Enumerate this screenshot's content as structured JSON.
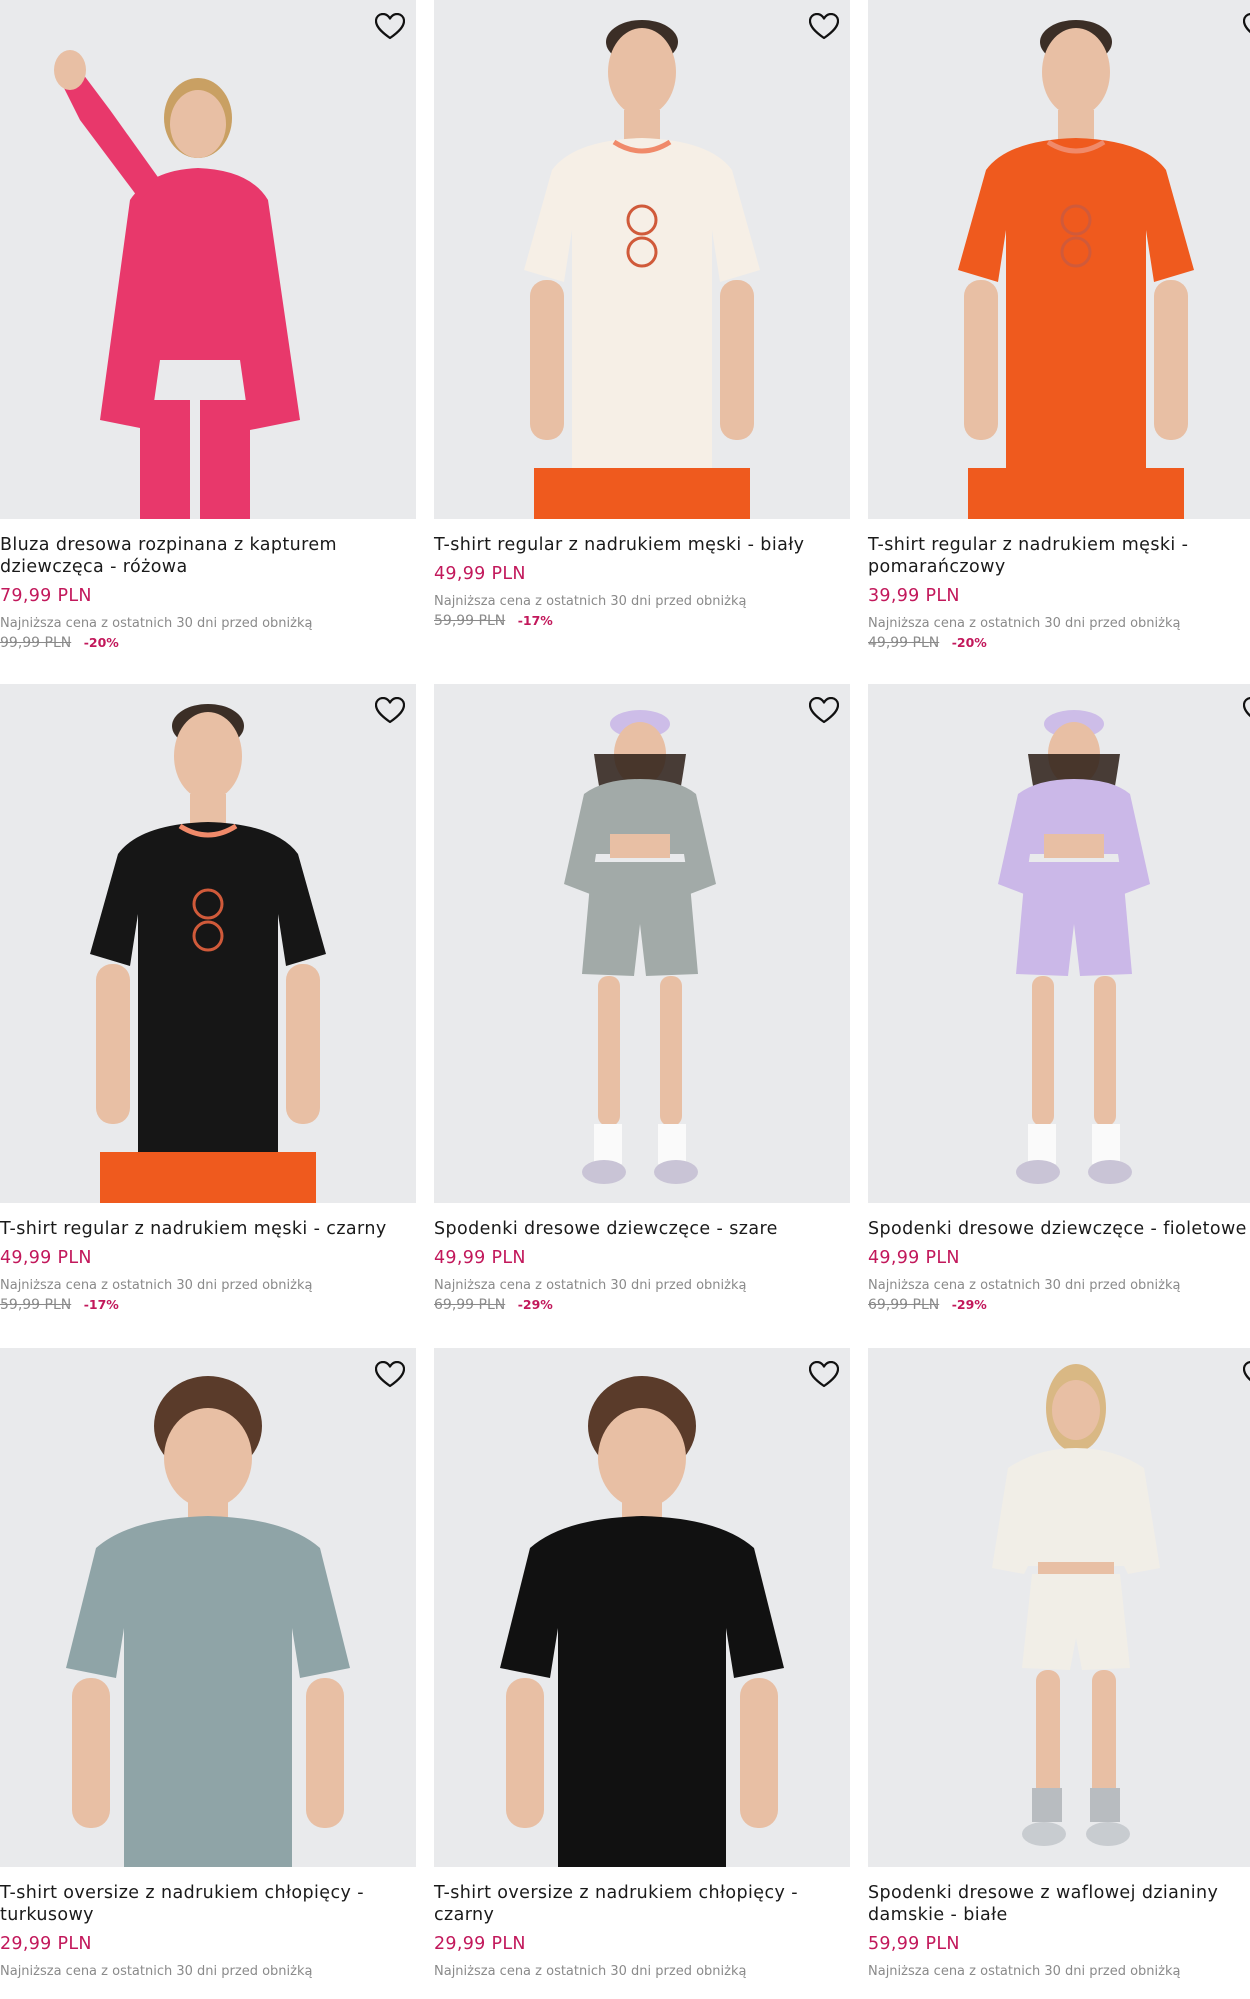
{
  "products": [
    {
      "title": "Bluza dresowa rozpinana z kapturem dziewczęca - różowa",
      "price": "79,99 PLN",
      "lowest_label": "Najniższa cena z ostatnich 30 dni przed obniżką",
      "old_price": "99,99 PLN",
      "discount": "-20%",
      "garment_color": "#e8386b",
      "model": "girl-hoodie"
    },
    {
      "title": "T-shirt regular z nadrukiem męski - biały",
      "price": "49,99 PLN",
      "lowest_label": "Najniższa cena z ostatnich 30 dni przed obniżką",
      "old_price": "59,99 PLN",
      "discount": "-17%",
      "garment_color": "#f6efe6",
      "model": "man-tee"
    },
    {
      "title": "T-shirt regular z nadrukiem męski - pomarańczowy",
      "price": "39,99 PLN",
      "lowest_label": "Najniższa cena z ostatnich 30 dni przed obniżką",
      "old_price": "49,99 PLN",
      "discount": "-20%",
      "garment_color": "#ef5a1e",
      "model": "man-tee"
    },
    {
      "title": "T-shirt regular z nadrukiem męski - czarny",
      "price": "49,99 PLN",
      "lowest_label": "Najniższa cena z ostatnich 30 dni przed obniżką",
      "old_price": "59,99 PLN",
      "discount": "-17%",
      "garment_color": "#161616",
      "model": "man-tee"
    },
    {
      "title": "Spodenki dresowe dziewczęce - szare",
      "price": "49,99 PLN",
      "lowest_label": "Najniższa cena z ostatnich 30 dni przed obniżką",
      "old_price": "69,99 PLN",
      "discount": "-29%",
      "garment_color": "#a2aaa8",
      "model": "girl-shorts"
    },
    {
      "title": "Spodenki dresowe dziewczęce - fioletowe",
      "price": "49,99 PLN",
      "lowest_label": "Najniższa cena z ostatnich 30 dni przed obniżką",
      "old_price": "69,99 PLN",
      "discount": "-29%",
      "garment_color": "#cbb8e8",
      "model": "girl-shorts"
    },
    {
      "title": "T-shirt oversize z nadrukiem chłopięcy - turkusowy",
      "price": "29,99 PLN",
      "lowest_label": "Najniższa cena z ostatnich 30 dni przed obniżką",
      "old_price": "",
      "discount": "",
      "garment_color": "#8fa4a7",
      "model": "boy-tee"
    },
    {
      "title": "T-shirt oversize z nadrukiem chłopięcy - czarny",
      "price": "29,99 PLN",
      "lowest_label": "Najniższa cena z ostatnich 30 dni przed obniżką",
      "old_price": "",
      "discount": "",
      "garment_color": "#111111",
      "model": "boy-tee"
    },
    {
      "title": "Spodenki dresowe z waflowej dzianiny damskie - białe",
      "price": "59,99 PLN",
      "lowest_label": "Najniższa cena z ostatnich 30 dni przed obniżką",
      "old_price": "",
      "discount": "",
      "garment_color": "#f1eee7",
      "model": "woman-shorts"
    }
  ],
  "icons": {
    "favorite": "heart-outline-icon"
  },
  "colors": {
    "price": "#c2185b",
    "muted": "#8a8a8a",
    "image_bg": "#e9eaec"
  }
}
